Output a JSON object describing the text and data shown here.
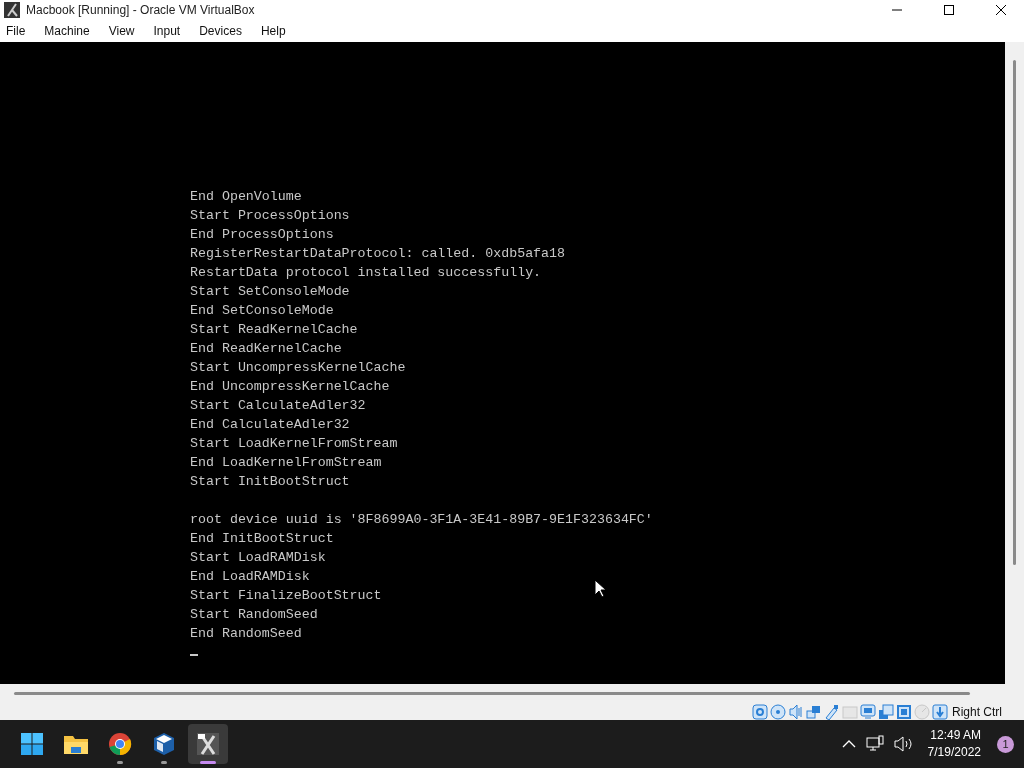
{
  "window": {
    "title": "Macbook [Running] - Oracle VM VirtualBox"
  },
  "menu": [
    "File",
    "Machine",
    "View",
    "Input",
    "Devices",
    "Help"
  ],
  "console_blocks": [
    [
      "End OpenVolume",
      "Start ProcessOptions",
      "End ProcessOptions",
      "RegisterRestartDataProtocol: called. 0xdb5afa18",
      "RestartData protocol installed successfully.",
      "Start SetConsoleMode",
      "End SetConsoleMode",
      "Start ReadKernelCache",
      "End ReadKernelCache",
      "Start UncompressKernelCache",
      "End UncompressKernelCache",
      "Start CalculateAdler32",
      "End CalculateAdler32",
      "Start LoadKernelFromStream",
      "End LoadKernelFromStream",
      "Start InitBootStruct"
    ],
    [
      "root device uuid is '8F8699A0-3F1A-3E41-89B7-9E1F323634FC'",
      "End InitBootStruct",
      "Start LoadRAMDisk",
      "End LoadRAMDisk",
      "Start FinalizeBootStruct",
      "Start RandomSeed",
      "End RandomSeed"
    ]
  ],
  "status_bar": {
    "indicators": [
      {
        "kind": "disk",
        "on": true
      },
      {
        "kind": "optical",
        "on": true
      },
      {
        "kind": "audio",
        "on": true
      },
      {
        "kind": "network",
        "on": true
      },
      {
        "kind": "usb",
        "on": true
      },
      {
        "kind": "folder",
        "on": false
      },
      {
        "kind": "display",
        "on": true
      },
      {
        "kind": "capture",
        "on": true
      },
      {
        "kind": "cpu",
        "on": true
      },
      {
        "kind": "mouse",
        "on": false
      },
      {
        "kind": "keyboard",
        "on": true
      }
    ],
    "host_key": "Right Ctrl"
  },
  "taskbar": {
    "apps": [
      {
        "kind": "start",
        "running": false,
        "selected": false
      },
      {
        "kind": "folder",
        "running": false,
        "selected": false
      },
      {
        "kind": "browser",
        "running": true,
        "selected": false
      },
      {
        "kind": "cube",
        "running": true,
        "selected": false
      },
      {
        "kind": "vm",
        "running": true,
        "selected": true
      }
    ],
    "time": "12:49 AM",
    "date": "7/19/2022",
    "notifications": "1"
  }
}
